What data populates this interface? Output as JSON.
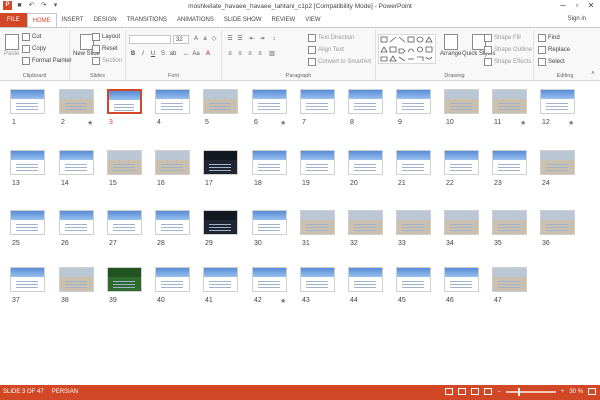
{
  "window": {
    "title": "moshkelate_havaee_havaee_tahtani_c1p2 [Compatibility Mode] - PowerPoint",
    "minimize": "─",
    "restore": "▫",
    "close": "✕"
  },
  "quick_access": {
    "app_icon": "P",
    "save": "■",
    "undo": "↶",
    "redo": "↷",
    "customize": "▾"
  },
  "tabs": [
    "FILE",
    "HOME",
    "INSERT",
    "DESIGN",
    "TRANSITIONS",
    "ANIMATIONS",
    "SLIDE SHOW",
    "REVIEW",
    "VIEW"
  ],
  "sign_in": "Sign in",
  "ribbon": {
    "clipboard": {
      "paste": "Paste",
      "cut": "Cut",
      "copy": "Copy",
      "format_painter": "Format Painter",
      "label": "Clipboard"
    },
    "slides": {
      "new_slide": "New Slide",
      "layout": "Layout",
      "reset": "Reset",
      "section": "Section",
      "label": "Slides"
    },
    "font": {
      "size": "32",
      "label": "Font"
    },
    "paragraph": {
      "text_direction": "Text Direction",
      "align_text": "Align Text",
      "convert": "Convert to SmartArt",
      "label": "Paragraph"
    },
    "drawing": {
      "arrange": "Arrange",
      "quick_styles": "Quick Styles",
      "shape_fill": "Shape Fill",
      "shape_outline": "Shape Outline",
      "shape_effects": "Shape Effects",
      "label": "Drawing"
    },
    "editing": {
      "find": "Find",
      "replace": "Replace",
      "select": "Select",
      "label": "Editing"
    }
  },
  "slides": [
    {
      "n": "1",
      "star": ""
    },
    {
      "n": "2",
      "star": "★"
    },
    {
      "n": "3",
      "star": "",
      "selected": true
    },
    {
      "n": "4",
      "star": ""
    },
    {
      "n": "5",
      "star": ""
    },
    {
      "n": "6",
      "star": "★"
    },
    {
      "n": "7",
      "star": ""
    },
    {
      "n": "8",
      "star": ""
    },
    {
      "n": "9",
      "star": ""
    },
    {
      "n": "10",
      "star": ""
    },
    {
      "n": "11",
      "star": "★"
    },
    {
      "n": "12",
      "star": "★"
    },
    {
      "n": "13",
      "star": ""
    },
    {
      "n": "14",
      "star": ""
    },
    {
      "n": "15",
      "star": ""
    },
    {
      "n": "16",
      "star": ""
    },
    {
      "n": "17",
      "star": ""
    },
    {
      "n": "18",
      "star": ""
    },
    {
      "n": "19",
      "star": ""
    },
    {
      "n": "20",
      "star": ""
    },
    {
      "n": "21",
      "star": ""
    },
    {
      "n": "22",
      "star": ""
    },
    {
      "n": "23",
      "star": ""
    },
    {
      "n": "24",
      "star": ""
    },
    {
      "n": "25",
      "star": ""
    },
    {
      "n": "26",
      "star": ""
    },
    {
      "n": "27",
      "star": ""
    },
    {
      "n": "28",
      "star": ""
    },
    {
      "n": "29",
      "star": ""
    },
    {
      "n": "30",
      "star": ""
    },
    {
      "n": "31",
      "star": ""
    },
    {
      "n": "32",
      "star": ""
    },
    {
      "n": "33",
      "star": ""
    },
    {
      "n": "34",
      "star": ""
    },
    {
      "n": "35",
      "star": ""
    },
    {
      "n": "36",
      "star": ""
    },
    {
      "n": "37",
      "star": ""
    },
    {
      "n": "38",
      "star": ""
    },
    {
      "n": "39",
      "star": ""
    },
    {
      "n": "40",
      "star": ""
    },
    {
      "n": "41",
      "star": ""
    },
    {
      "n": "42",
      "star": "★"
    },
    {
      "n": "43",
      "star": ""
    },
    {
      "n": "44",
      "star": ""
    },
    {
      "n": "45",
      "star": ""
    },
    {
      "n": "46",
      "star": ""
    },
    {
      "n": "47",
      "star": ""
    }
  ],
  "status": {
    "slide": "SLIDE 3 OF 47",
    "language": "PERSIAN",
    "zoom": "30 %",
    "zoom_out": "−",
    "zoom_in": "+"
  },
  "colors": {
    "accent": "#d24726",
    "ribbon_bg": "#f8f8f8",
    "slide_band": "#3a78d0"
  }
}
